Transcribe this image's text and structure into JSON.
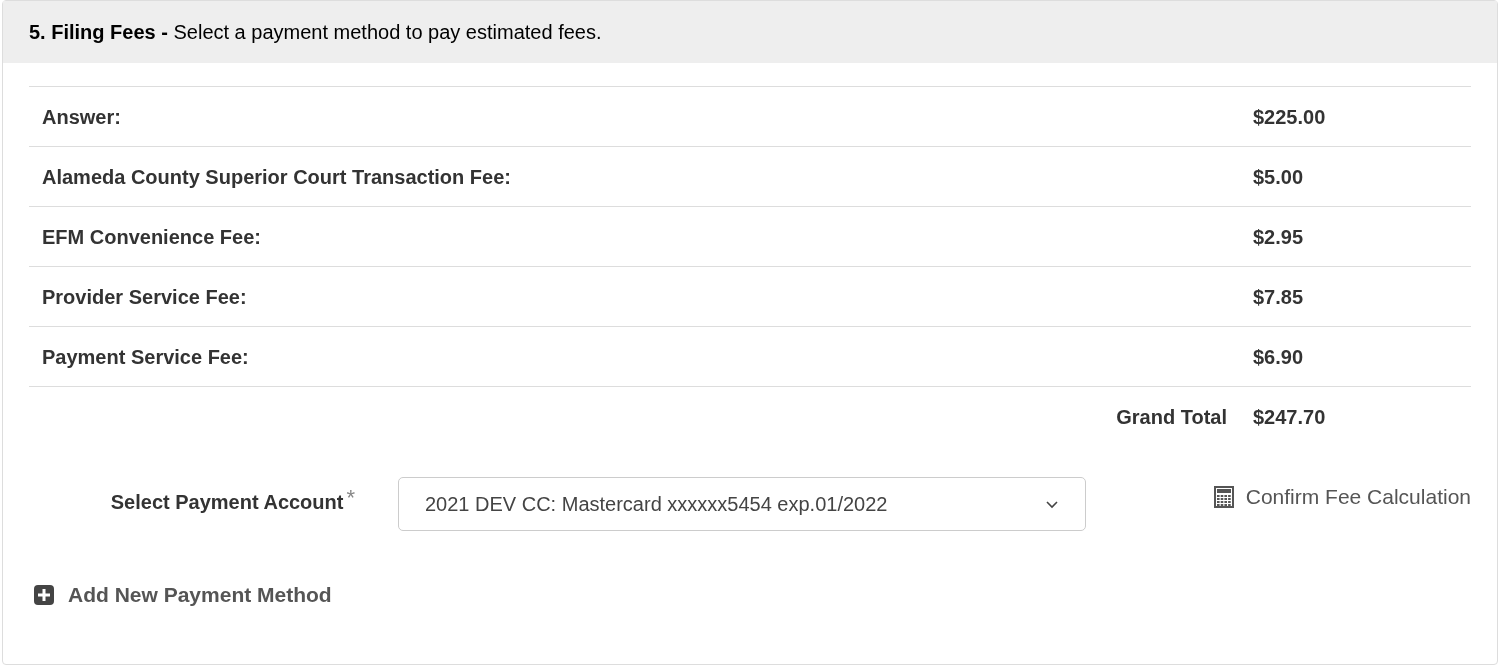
{
  "panel": {
    "heading": "**5. Filing Fees -** Select a payment method to pay estimated fees."
  },
  "fees": [
    {
      "label": "Answer:",
      "amount": "$225.00"
    },
    {
      "label": "Alameda County Superior Court Transaction Fee:",
      "amount": "$5.00"
    },
    {
      "label": "EFM Convenience Fee:",
      "amount": "$2.95"
    },
    {
      "label": "Provider Service Fee:",
      "amount": "$7.85"
    },
    {
      "label": "Payment Service Fee:",
      "amount": "$6.90"
    }
  ],
  "total": {
    "label": "Grand Total",
    "amount": "$247.70"
  },
  "payment_account": {
    "label": "Select Payment Account",
    "required_mark": "*",
    "value": "2021 DEV CC: Mastercard xxxxxx5454 exp.01/2022"
  },
  "confirm_link": "Confirm Fee Calculation",
  "add_method_link": "Add New Payment Method"
}
